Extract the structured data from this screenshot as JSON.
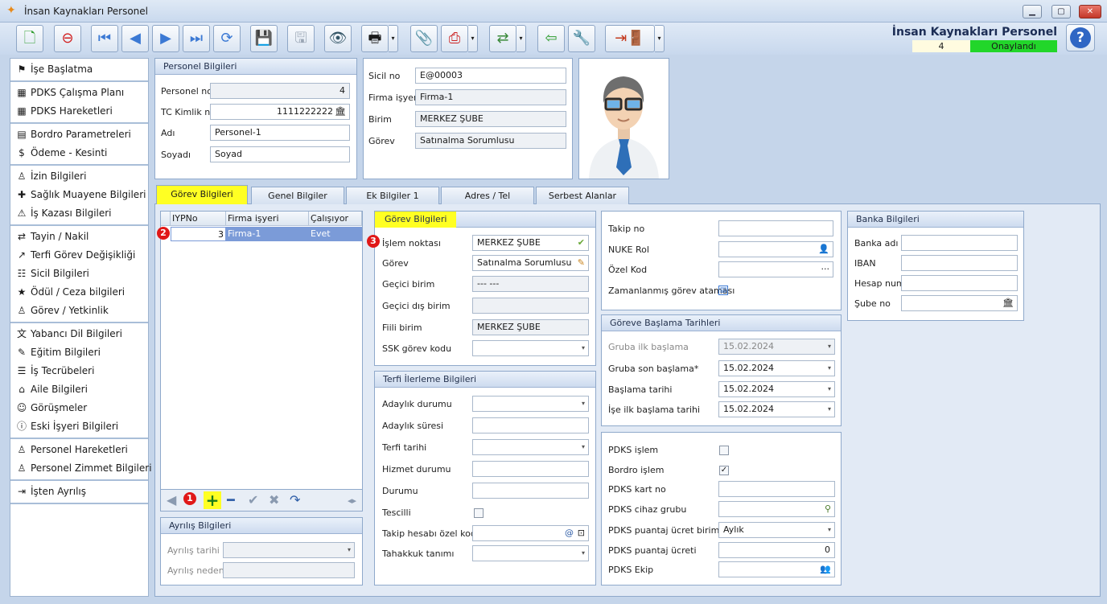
{
  "window": {
    "title": "İnsan Kaynakları Personel"
  },
  "header": {
    "app_title": "İnsan Kaynakları Personel",
    "record_no": "4",
    "status": "Onaylandı"
  },
  "sidebar": {
    "groups": [
      [
        "İşe Başlatma"
      ],
      [
        "PDKS Çalışma Planı",
        "PDKS Hareketleri"
      ],
      [
        "Bordro Parametreleri",
        "Ödeme - Kesinti"
      ],
      [
        "İzin Bilgileri",
        "Sağlık Muayene Bilgileri",
        "İş Kazası Bilgileri"
      ],
      [
        "Tayin / Nakil",
        "Terfi Görev Değişikliği",
        "Sicil Bilgileri",
        "Ödül / Ceza bilgileri",
        "Görev / Yetkinlik"
      ],
      [
        "Yabancı Dil Bilgileri",
        "Eğitim Bilgileri",
        "İş Tecrübeleri",
        "Aile Bilgileri",
        "Görüşmeler",
        "Eski İşyeri Bilgileri"
      ],
      [
        "Personel Hareketleri",
        "Personel Zimmet Bilgileri"
      ],
      [
        "İşten Ayrılış"
      ]
    ]
  },
  "personel": {
    "header": "Personel Bilgileri",
    "no_label": "Personel no",
    "no": "4",
    "tc_label": "TC Kimlik no",
    "tc": "1111222222",
    "adi_label": "Adı",
    "adi": "Personel-1",
    "soyadi_label": "Soyadı",
    "soyadi": "Soyad"
  },
  "sicil": {
    "sicil_label": "Sicil no",
    "sicil": "E@00003",
    "firma_label": "Firma işyeri",
    "firma": "Firma-1",
    "birim_label": "Birim",
    "birim": "MERKEZ ŞUBE",
    "gorev_label": "Görev",
    "gorev": "Satınalma Sorumlusu"
  },
  "tabs": [
    "Görev Bilgileri",
    "Genel Bilgiler",
    "Ek Bilgiler 1",
    "Adres / Tel",
    "Serbest Alanlar"
  ],
  "grid": {
    "columns": [
      "IYPNo",
      "Firma işyeri",
      "Çalışıyor"
    ],
    "rows": [
      [
        "3",
        "Firma-1",
        "Evet"
      ]
    ]
  },
  "badges": {
    "b1": "1",
    "b2": "2",
    "b3": "3"
  },
  "ayrilis": {
    "header": "Ayrılış Bilgileri",
    "tarih_label": "Ayrılış tarihi",
    "neden_label": "Ayrılış nedeni"
  },
  "gorev": {
    "header": "Görev Bilgileri",
    "islem_label": "İşlem noktası",
    "islem": "MERKEZ ŞUBE",
    "gorev_label": "Görev",
    "gorev": "Satınalma Sorumlusu",
    "gecici_label": "Geçici birim",
    "gecici": "--- ---",
    "gecici_dis_label": "Geçici dış birim",
    "fiili_label": "Fiili birim",
    "fiili": "MERKEZ ŞUBE",
    "ssk_label": "SSK görev kodu"
  },
  "terfi": {
    "header": "Terfi İlerleme Bilgileri",
    "adaylik_durumu": "Adaylık durumu",
    "adaylik_suresi": "Adaylık süresi",
    "terfi_tarihi": "Terfi tarihi",
    "hizmet_durumu": "Hizmet durumu",
    "durumu": "Durumu",
    "tescilli": "Tescilli",
    "takip_ozel": "Takip hesabı özel kodu",
    "tahakkuk": "Tahakkuk tanımı"
  },
  "takip": {
    "takip_label": "Takip no",
    "nuke_label": "NUKE Rol",
    "ozel_label": "Özel Kod",
    "zaman_label": "Zamanlanmış görev ataması"
  },
  "baslama": {
    "header": "Göreve Başlama Tarihleri",
    "gruba_ilk_label": "Gruba ilk başlama",
    "gruba_ilk": "15.02.2024",
    "gruba_son_label": "Gruba son başlama*",
    "gruba_son": "15.02.2024",
    "baslama_label": "Başlama tarihi",
    "baslama": "15.02.2024",
    "ise_ilk_label": "İşe ilk başlama tarihi",
    "ise_ilk": "15.02.2024"
  },
  "pdks": {
    "islem_label": "PDKS işlem",
    "bordro_label": "Bordro işlem",
    "kart_label": "PDKS kart no",
    "cihaz_label": "PDKS cihaz grubu",
    "birim_label": "PDKS puantaj ücret birimi",
    "birim": "Aylık",
    "ucret_label": "PDKS puantaj ücreti",
    "ucret": "0",
    "ekip_label": "PDKS Ekip"
  },
  "banka": {
    "header": "Banka Bilgileri",
    "adi_label": "Banka adı",
    "iban_label": "IBAN",
    "hesap_label": "Hesap num",
    "sube_label": "Şube no"
  },
  "colors": {
    "accent": "#ffff23",
    "status": "#22d62a",
    "badge": "#e01818"
  }
}
